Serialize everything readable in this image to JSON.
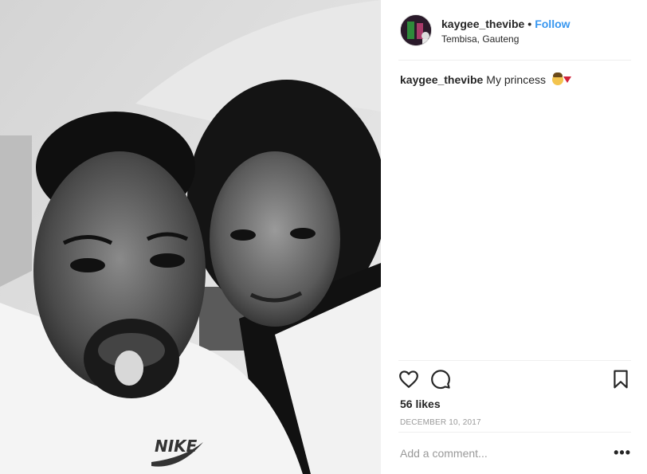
{
  "post": {
    "username": "kaygee_thevibe",
    "separator": "•",
    "follow_label": "Follow",
    "location": "Tembisa, Gauteng",
    "caption_text": "My princess",
    "caption_emojis": [
      "woman-face-emoji",
      "gem-emoji"
    ],
    "likes": "56 likes",
    "date": "DECEMBER 10, 2017",
    "photo_logo_text": "NIKE"
  },
  "comment": {
    "placeholder": "Add a comment...",
    "more_label": "•••"
  },
  "icons": {
    "like": "heart-icon",
    "comment": "comment-icon",
    "save": "bookmark-icon",
    "more": "more-options-icon"
  },
  "colors": {
    "follow": "#3897f0",
    "text": "#262626",
    "muted": "#999999",
    "divider": "#efefef"
  }
}
